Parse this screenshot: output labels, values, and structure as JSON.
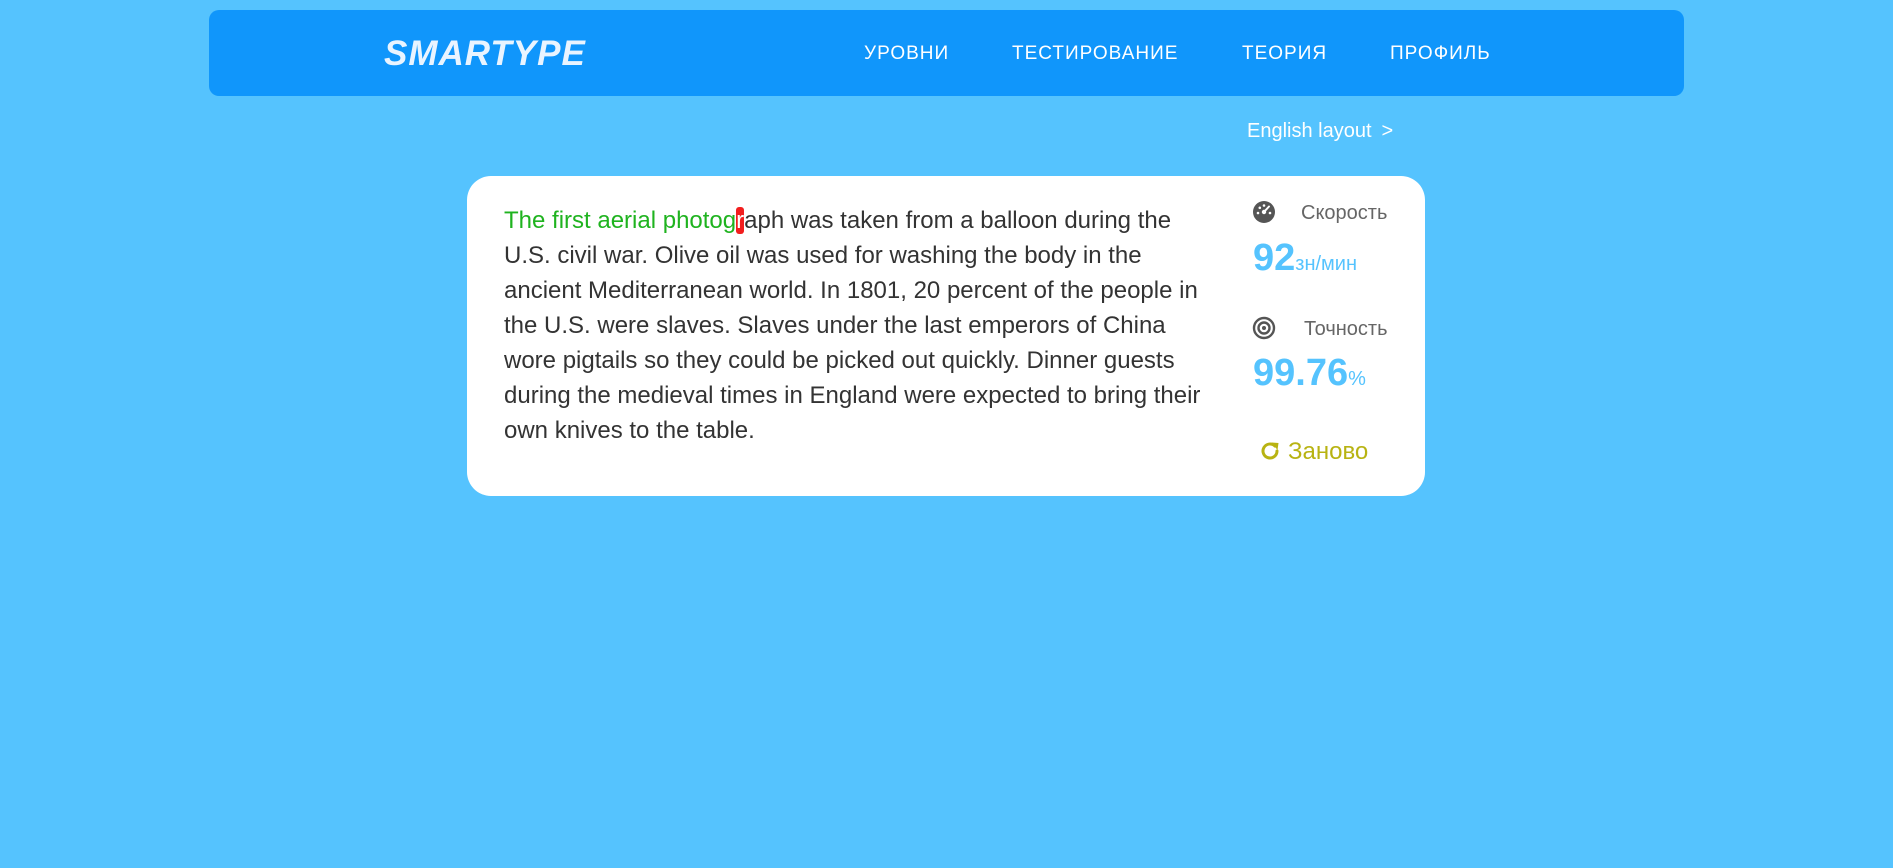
{
  "header": {
    "logo": "SMARTYPE",
    "nav": [
      {
        "label": "УРОВНИ"
      },
      {
        "label": "ТЕСТИРОВАНИЕ"
      },
      {
        "label": "ТЕОРИЯ"
      },
      {
        "label": "ПРОФИЛЬ"
      }
    ]
  },
  "layout_switch": {
    "label": "English layout",
    "arrow": ">"
  },
  "typing": {
    "typed_text": "The first aerial photog",
    "current_char": "r",
    "remaining_text": "aph was taken from a balloon during the U.S. civil war. Olive oil was used for washing the body in the ancient Mediterranean world. In 1801, 20 percent of the people in the U.S. were slaves. Slaves under the last emperors of China wore pigtails so they could be picked out quickly. Dinner guests during the medieval times in England were expected to bring their own knives to the table."
  },
  "stats": {
    "speed": {
      "label": "Скорость",
      "value": "92",
      "unit": "зн/мин",
      "icon": "speedometer-icon"
    },
    "accuracy": {
      "label": "Точность",
      "value": "99.76",
      "unit": "%",
      "icon": "target-icon"
    }
  },
  "restart": {
    "label": "Заново",
    "icon": "refresh-icon"
  },
  "colors": {
    "background": "#55c3fe",
    "header": "#1096fb",
    "typed": "#1fb31f",
    "error_cursor": "#f21e1e",
    "stat_value": "#55c3fe",
    "restart": "#b8b312"
  }
}
